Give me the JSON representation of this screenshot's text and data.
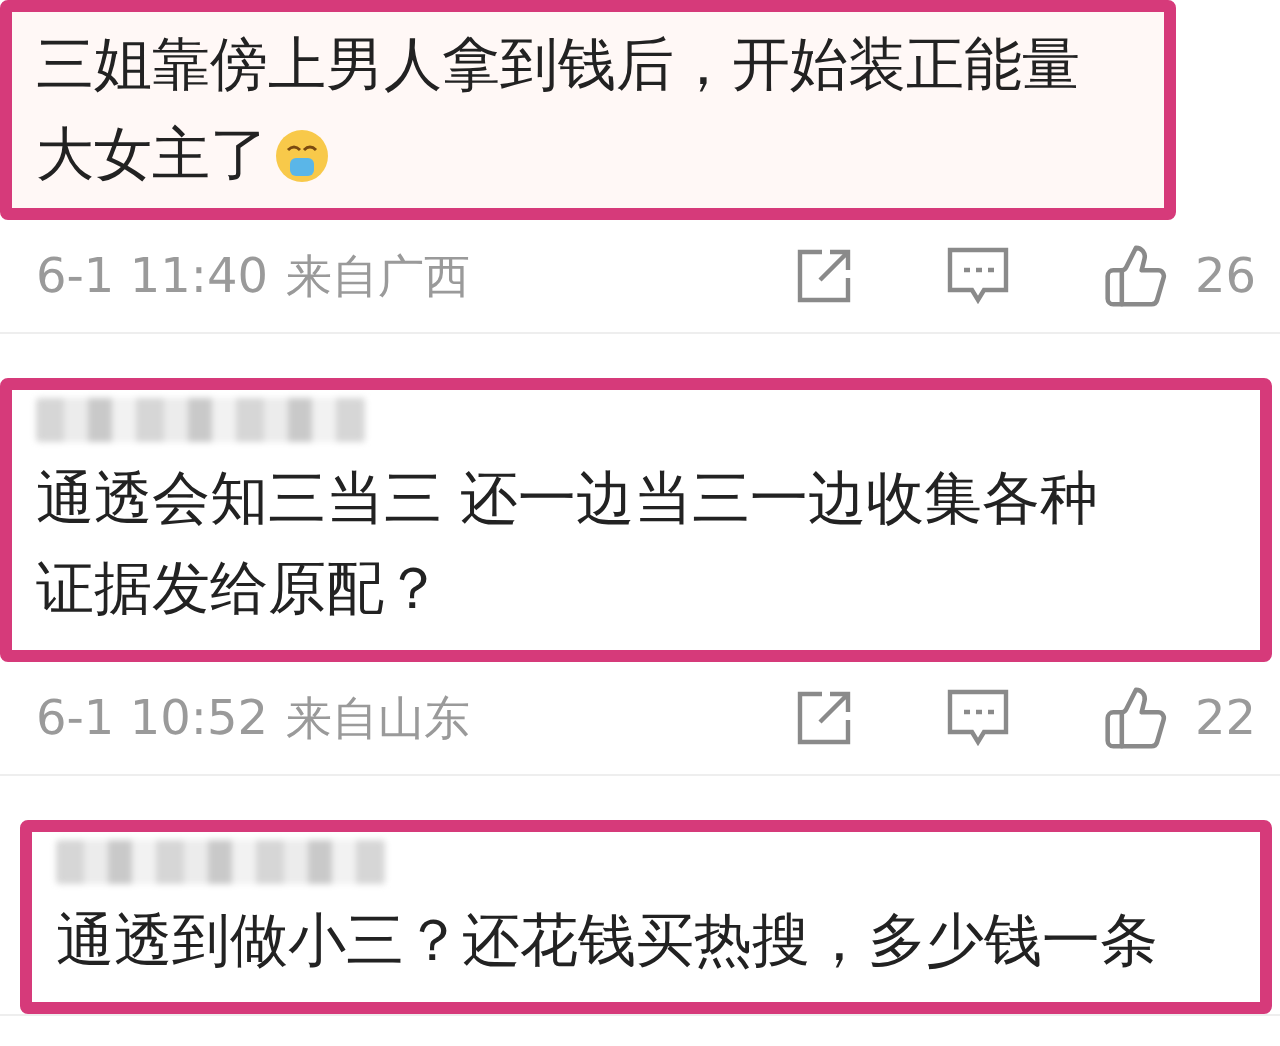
{
  "comments": [
    {
      "highlighted": true,
      "username_blurred": false,
      "lines": [
        "三姐靠傍上男人拿到钱后，开始装正能量",
        "大女主了"
      ],
      "emoji": true,
      "time": "6-1 11:40",
      "location": "来自广西",
      "likes": "26"
    },
    {
      "highlighted": true,
      "username_blurred": true,
      "lines": [
        "通透会知三当三 还一边当三一边收集各种",
        "证据发给原配？"
      ],
      "emoji": false,
      "time": "6-1 10:52",
      "location": "来自山东",
      "likes": "22"
    },
    {
      "highlighted": true,
      "username_blurred": true,
      "lines": [
        "通透到做小三？还花钱买热搜，多少钱一条"
      ]
    }
  ]
}
